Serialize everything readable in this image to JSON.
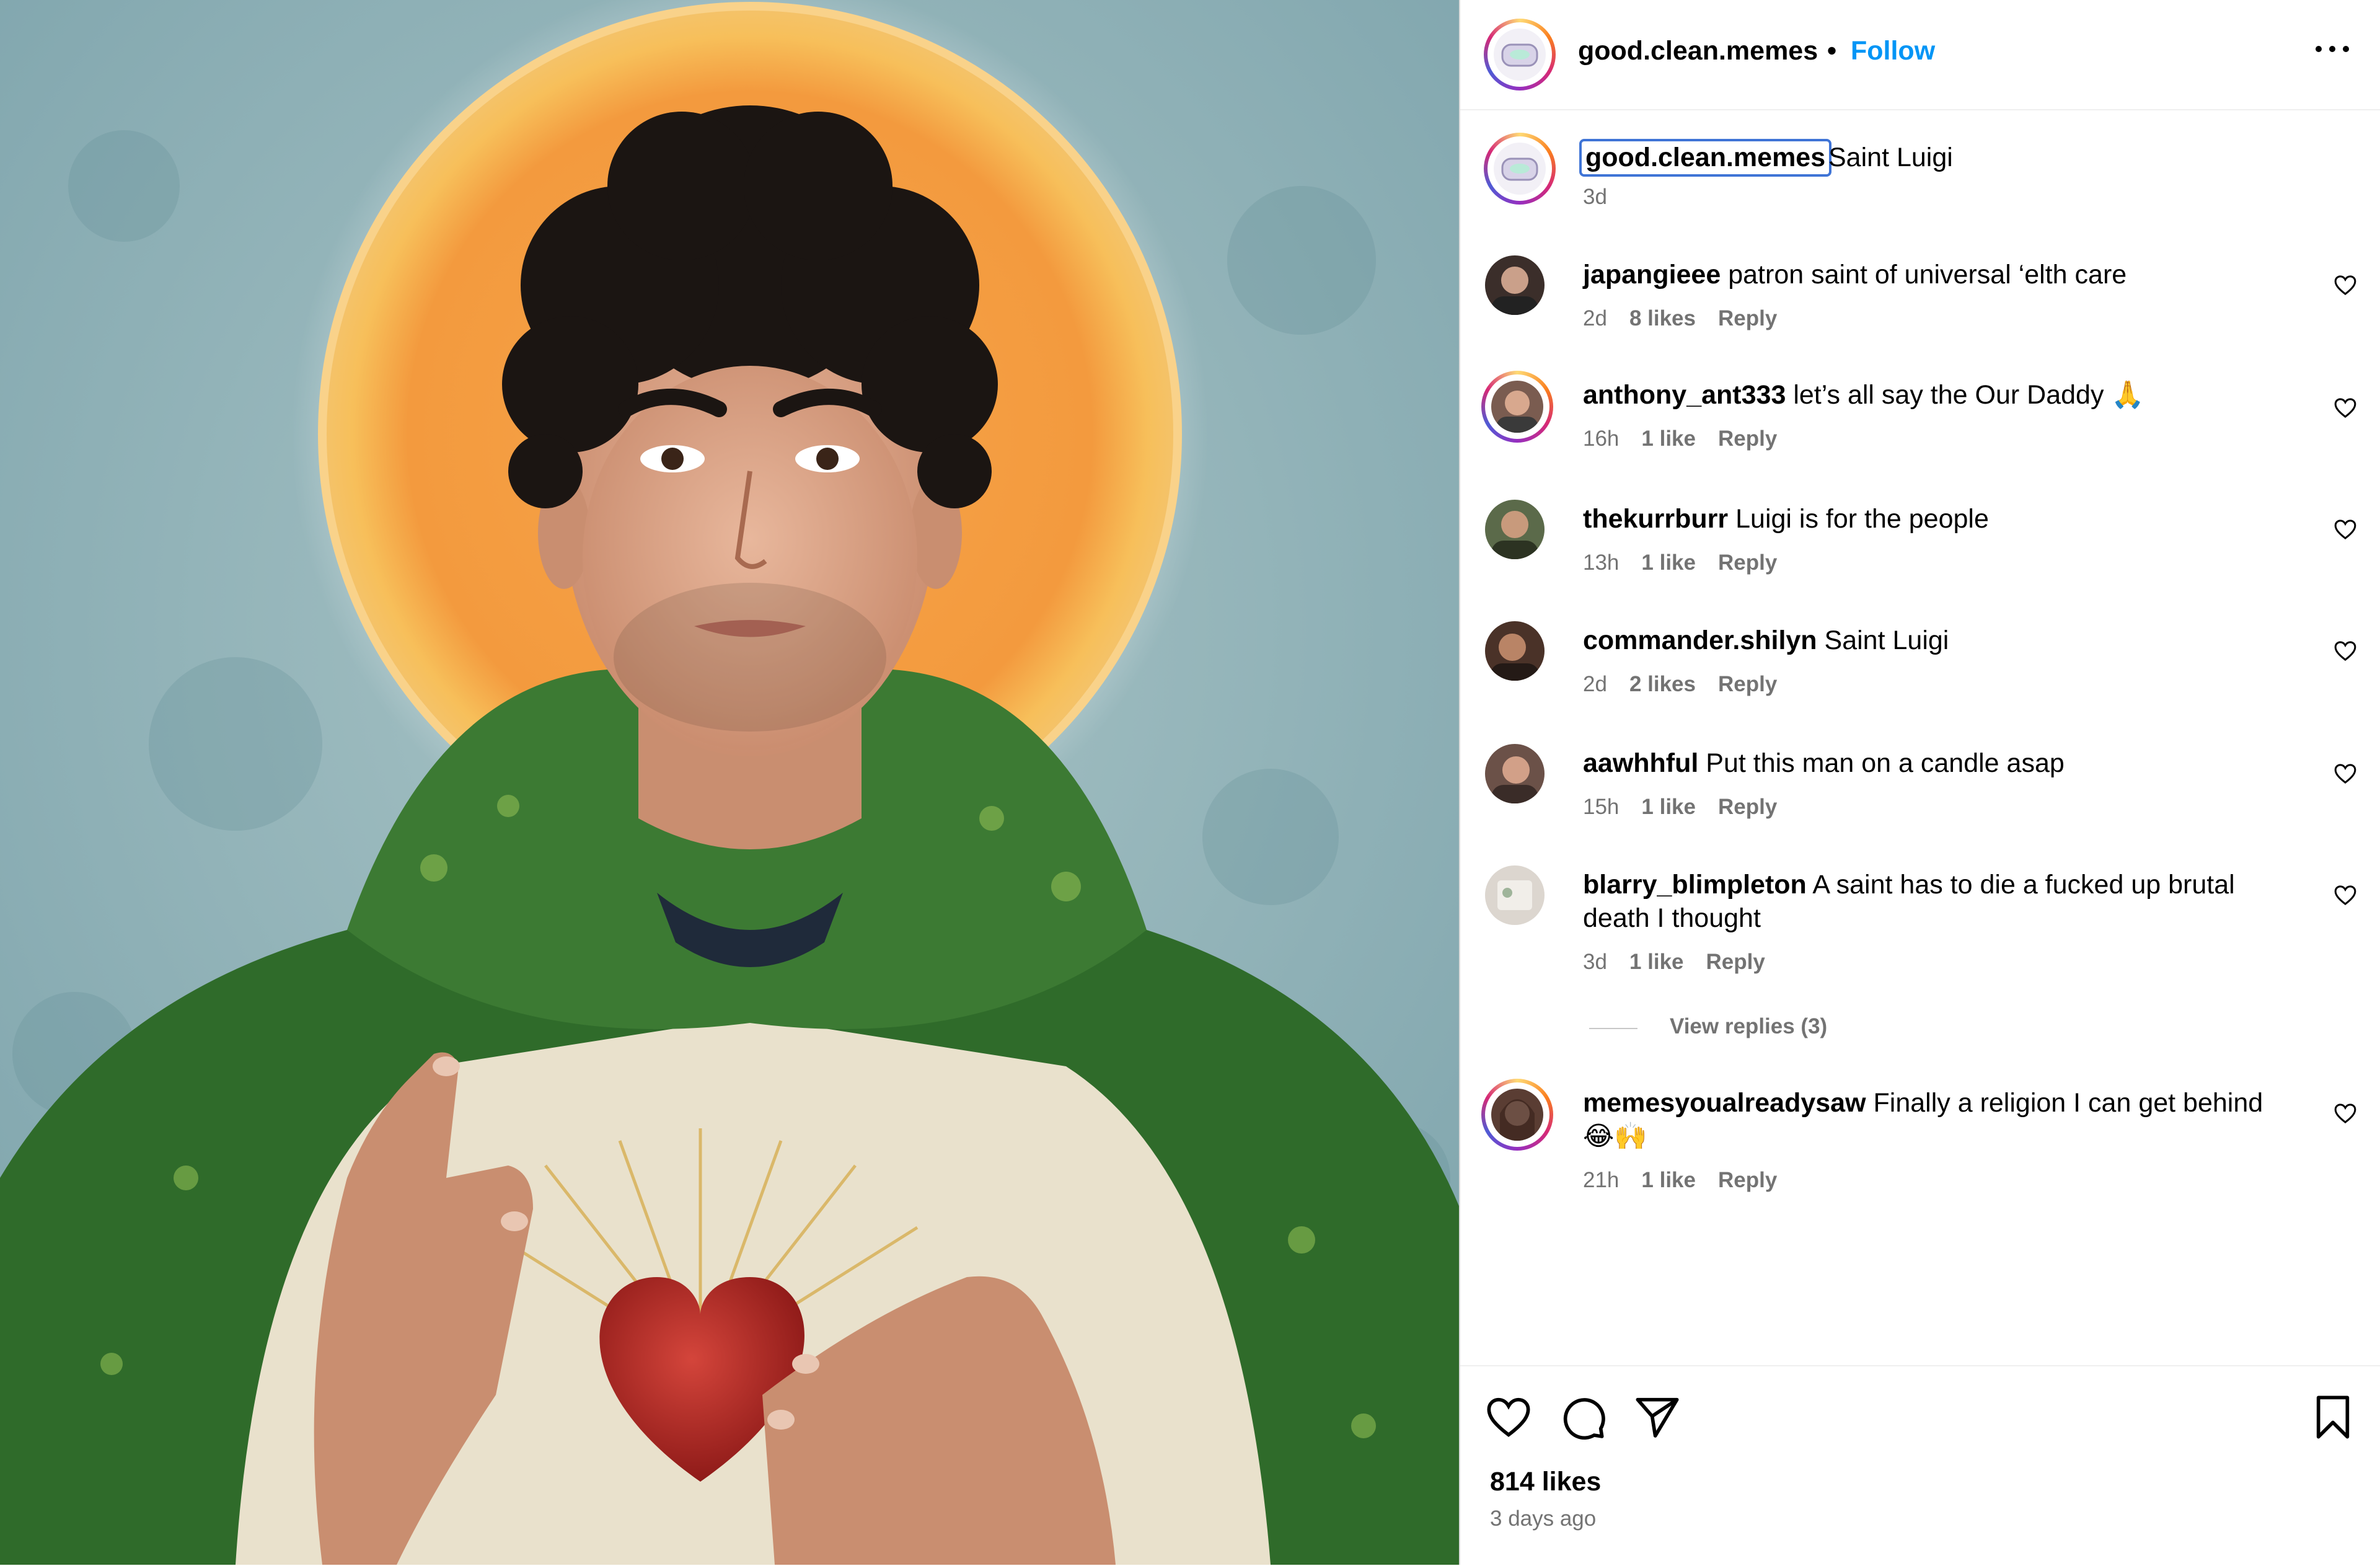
{
  "post": {
    "username": "good.clean.memes",
    "separator": "•",
    "follow_label": "Follow",
    "caption_text": "Saint Luigi",
    "caption_time": "3d",
    "likes_text": "814 likes",
    "posted_ago": "3 days ago"
  },
  "comments": [
    {
      "user": "japangieee",
      "text": "patron saint of universal ‘elth care",
      "time": "2d",
      "likes": "8 likes",
      "reply": "Reply"
    },
    {
      "user": "anthony_ant333",
      "text": "let’s all say the Our Daddy 🙏",
      "time": "16h",
      "likes": "1 like",
      "reply": "Reply"
    },
    {
      "user": "thekurrburr",
      "text": "Luigi is for the people",
      "time": "13h",
      "likes": "1 like",
      "reply": "Reply"
    },
    {
      "user": "commander.shilyn",
      "text": "Saint Luigi",
      "time": "2d",
      "likes": "2 likes",
      "reply": "Reply"
    },
    {
      "user": "aawhhful",
      "text": "Put this man on a candle asap",
      "time": "15h",
      "likes": "1 like",
      "reply": "Reply"
    },
    {
      "user": "blarry_blimpleton",
      "text": "A saint has to die a fucked up brutal death I thought",
      "time": "3d",
      "likes": "1 like",
      "reply": "Reply"
    },
    {
      "user": "memesyoualreadysaw",
      "text": "Finally a religion I can get behind 😂🙌",
      "time": "21h",
      "likes": "1 like",
      "reply": "Reply"
    }
  ],
  "view_replies": "View replies (3)",
  "icons": {
    "more": "more-options-icon",
    "like": "heart-icon",
    "comment": "comment-icon",
    "share": "paper-plane-icon",
    "save": "bookmark-icon"
  },
  "colors": {
    "link_blue": "#0095f6",
    "muted_text": "#737373",
    "divider": "#efefef"
  }
}
